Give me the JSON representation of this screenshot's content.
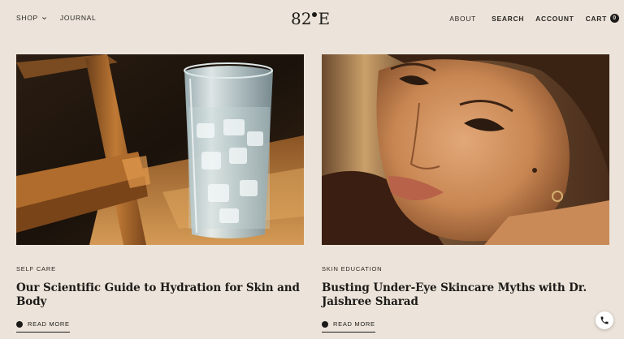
{
  "header": {
    "nav_left": [
      {
        "label": "SHOP",
        "dropdown": true
      },
      {
        "label": "JOURNAL",
        "dropdown": false
      }
    ],
    "logo": {
      "left": "82",
      "right": "E"
    },
    "nav_right": {
      "about": "ABOUT",
      "search": "SEARCH",
      "account": "ACCOUNT",
      "cart": "CART",
      "cart_count": "0"
    }
  },
  "articles": [
    {
      "category": "SELF CARE",
      "title": "Our Scientific Guide to Hydration for Skin and Body",
      "read_more": "READ MORE",
      "image": "glass-of-ice-water"
    },
    {
      "category": "SKIN EDUCATION",
      "title": "Busting Under-Eye Skincare Myths with Dr. Jaishree Sharad",
      "read_more": "READ MORE",
      "image": "woman-portrait"
    }
  ],
  "colors": {
    "background": "#ece4da",
    "text": "#1d1b19",
    "accent": "#1d1b19"
  },
  "icons": {
    "chevron": "chevron-down-icon",
    "chat": "phone-chat-icon"
  }
}
